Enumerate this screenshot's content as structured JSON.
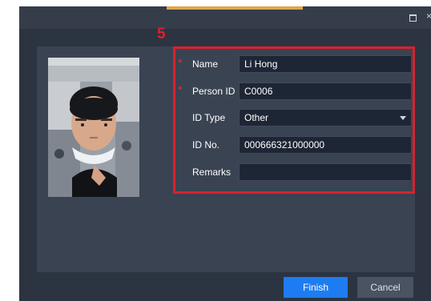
{
  "annotation": {
    "step_number": "5"
  },
  "form": {
    "fields": [
      {
        "label": "Name",
        "value": "Li Hong",
        "required": true
      },
      {
        "label": "Person ID",
        "value": "C0006",
        "required": true
      },
      {
        "label": "ID Type",
        "value": "Other",
        "required": false
      },
      {
        "label": "ID No.",
        "value": "000666321000000",
        "required": false
      },
      {
        "label": "Remarks",
        "value": "",
        "required": false
      }
    ]
  },
  "buttons": {
    "finish": "Finish",
    "cancel": "Cancel"
  },
  "colors": {
    "dialog_bg": "#2c3442",
    "panel_bg": "#3a4352",
    "input_bg": "#1e2635",
    "highlight": "#d8222e",
    "primary_button": "#1e7cf2",
    "secondary_button": "#4a5362"
  },
  "icons": {
    "maximize": "maximize-icon",
    "dropdown": "chevron-down-icon"
  }
}
